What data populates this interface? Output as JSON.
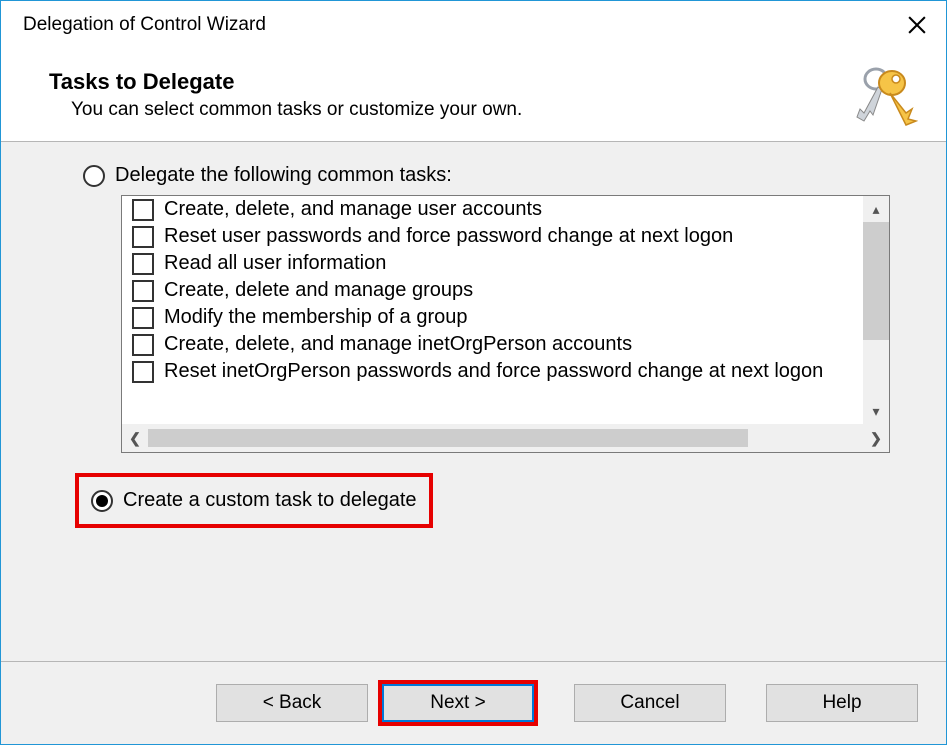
{
  "title": "Delegation of Control Wizard",
  "header": {
    "heading": "Tasks to Delegate",
    "subtitle": "You can select common tasks or customize your own."
  },
  "options": {
    "common": {
      "label": "Delegate the following common tasks:",
      "checked": false
    },
    "custom": {
      "label": "Create a custom task to delegate",
      "checked": true
    }
  },
  "tasks": [
    "Create, delete, and manage user accounts",
    "Reset user passwords and force password change at next logon",
    "Read all user information",
    "Create, delete and manage groups",
    "Modify the membership of a group",
    "Create, delete, and manage inetOrgPerson accounts",
    "Reset inetOrgPerson passwords and force password change at next logon"
  ],
  "buttons": {
    "back": "< Back",
    "next": "Next >",
    "cancel": "Cancel",
    "help": "Help"
  }
}
